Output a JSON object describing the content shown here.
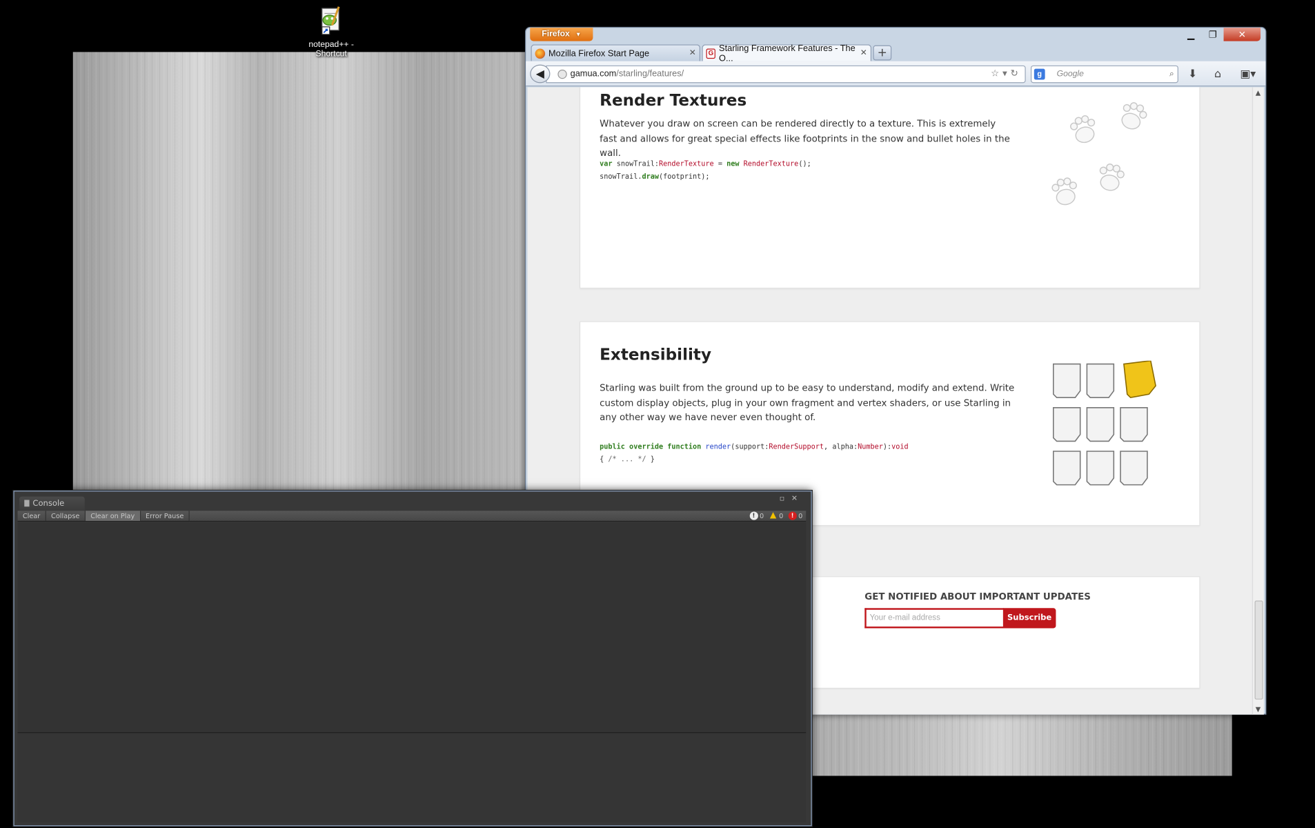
{
  "desktop": {
    "icon_label_1": "notepad++ -",
    "icon_label_2": "Shortcut"
  },
  "firefox": {
    "menu_button": "Firefox",
    "tabs": [
      {
        "title": "Mozilla Firefox Start Page"
      },
      {
        "title": "Starling Framework Features - The O..."
      }
    ],
    "url_host": "gamua.com",
    "url_path": "/starling/features/",
    "search_placeholder": "Google"
  },
  "page": {
    "render_textures": {
      "title": "Render Textures",
      "body": "Whatever you draw on screen can be rendered directly to a texture. This is extremely fast and allows for great special effects like footprints in the snow and bullet holes in the wall.",
      "code": [
        [
          {
            "t": "var",
            "c": "kw"
          },
          {
            "t": " snowTrail:",
            "c": ""
          },
          {
            "t": "RenderTexture",
            "c": "ty"
          },
          {
            "t": " = ",
            "c": ""
          },
          {
            "t": "new",
            "c": "kw"
          },
          {
            "t": " ",
            "c": ""
          },
          {
            "t": "RenderTexture",
            "c": "ty"
          },
          {
            "t": "();",
            "c": ""
          }
        ],
        [
          {
            "t": "snowTrail.",
            "c": ""
          },
          {
            "t": "draw",
            "c": "kw"
          },
          {
            "t": "(footprint);",
            "c": ""
          }
        ]
      ]
    },
    "extensibility": {
      "title": "Extensibility",
      "body": "Starling was built from the ground up to be easy to understand, modify and extend. Write custom display objects, plug in your own fragment and vertex shaders, or use Starling in any other way we have never even thought of.",
      "code": [
        [
          {
            "t": "public override function",
            "c": "kw"
          },
          {
            "t": " ",
            "c": ""
          },
          {
            "t": "render",
            "c": "fn"
          },
          {
            "t": "(support:",
            "c": ""
          },
          {
            "t": "RenderSupport",
            "c": "ty"
          },
          {
            "t": ", alpha:",
            "c": ""
          },
          {
            "t": "Number",
            "c": "ty"
          },
          {
            "t": "):",
            "c": ""
          },
          {
            "t": "void",
            "c": "ty"
          }
        ],
        [
          {
            "t": "{ ",
            "c": ""
          },
          {
            "t": "/* ... */",
            "c": "cm"
          },
          {
            "t": " }",
            "c": ""
          }
        ]
      ]
    },
    "notify": {
      "title": "GET NOTIFIED ABOUT IMPORTANT UPDATES",
      "email_placeholder": "Your e-mail address",
      "subscribe_label": "Subscribe"
    }
  },
  "console": {
    "title": "Console",
    "toolbar": {
      "clear": "Clear",
      "collapse": "Collapse",
      "clear_on_play": "Clear on Play",
      "error_pause": "Error Pause"
    },
    "counts": {
      "info": "0",
      "warnings": "0",
      "errors": "0"
    }
  },
  "colors": {
    "accent_red": "#c0171c",
    "firefox_orange": "#e8761a"
  }
}
